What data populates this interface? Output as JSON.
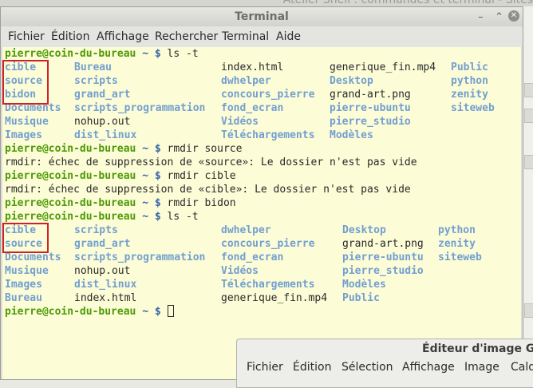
{
  "background": {
    "title_fragment": "Atelier Shell : commandes et terminal - Sites"
  },
  "terminal": {
    "title": "Terminal",
    "controls": {
      "minimize": "–",
      "maximize": "⌃",
      "close": "✕"
    },
    "menu": [
      "Fichier",
      "Édition",
      "Affichage",
      "Rechercher",
      "Terminal",
      "Aide"
    ],
    "prompt": {
      "user_host": "pierre@coin-du-bureau",
      "sep": " ~ $ "
    },
    "commands": {
      "c1": "ls -t",
      "c2": "rmdir source",
      "c3": "rmdir cible",
      "c4": "rmdir bidon",
      "c5": "ls -t"
    },
    "errors": {
      "e1": "rmdir: échec de suppression de «source»: Le dossier n'est pas vide",
      "e2": "rmdir: échec de suppression de «cible»: Le dossier n'est pas vide"
    },
    "listing1": [
      [
        "cible",
        "Bureau",
        "index.html",
        "generique_fin.mp4",
        "Public"
      ],
      [
        "source",
        "scripts",
        "dwhelper",
        "Desktop",
        "python"
      ],
      [
        "bidon",
        "grand_art",
        "concours_pierre",
        "grand-art.png",
        "zenity"
      ],
      [
        "Documents",
        "scripts_programmation",
        "fond_ecran",
        "pierre-ubuntu",
        "siteweb"
      ],
      [
        "Musique",
        "nohup.out",
        "Vidéos",
        "pierre_studio",
        ""
      ],
      [
        "Images",
        "dist_linux",
        "Téléchargements",
        "Modèles",
        ""
      ]
    ],
    "listing2": [
      [
        "cible",
        "scripts",
        "dwhelper",
        "Desktop",
        "python"
      ],
      [
        "source",
        "grand_art",
        "concours_pierre",
        "grand-art.png",
        "zenity"
      ],
      [
        "Documents",
        "scripts_programmation",
        "fond_ecran",
        "pierre-ubuntu",
        "siteweb"
      ],
      [
        "Musique",
        "nohup.out",
        "Vidéos",
        "pierre_studio",
        ""
      ],
      [
        "Images",
        "dist_linux",
        "Téléchargements",
        "Modèles",
        ""
      ],
      [
        "Bureau",
        "index.html",
        "generique_fin.mp4",
        "Public",
        ""
      ]
    ]
  },
  "gimp": {
    "title": "Éditeur d'image GIMP",
    "menu": [
      "Fichier",
      "Édition",
      "Sélection",
      "Affichage",
      "Image",
      "Calques"
    ]
  }
}
